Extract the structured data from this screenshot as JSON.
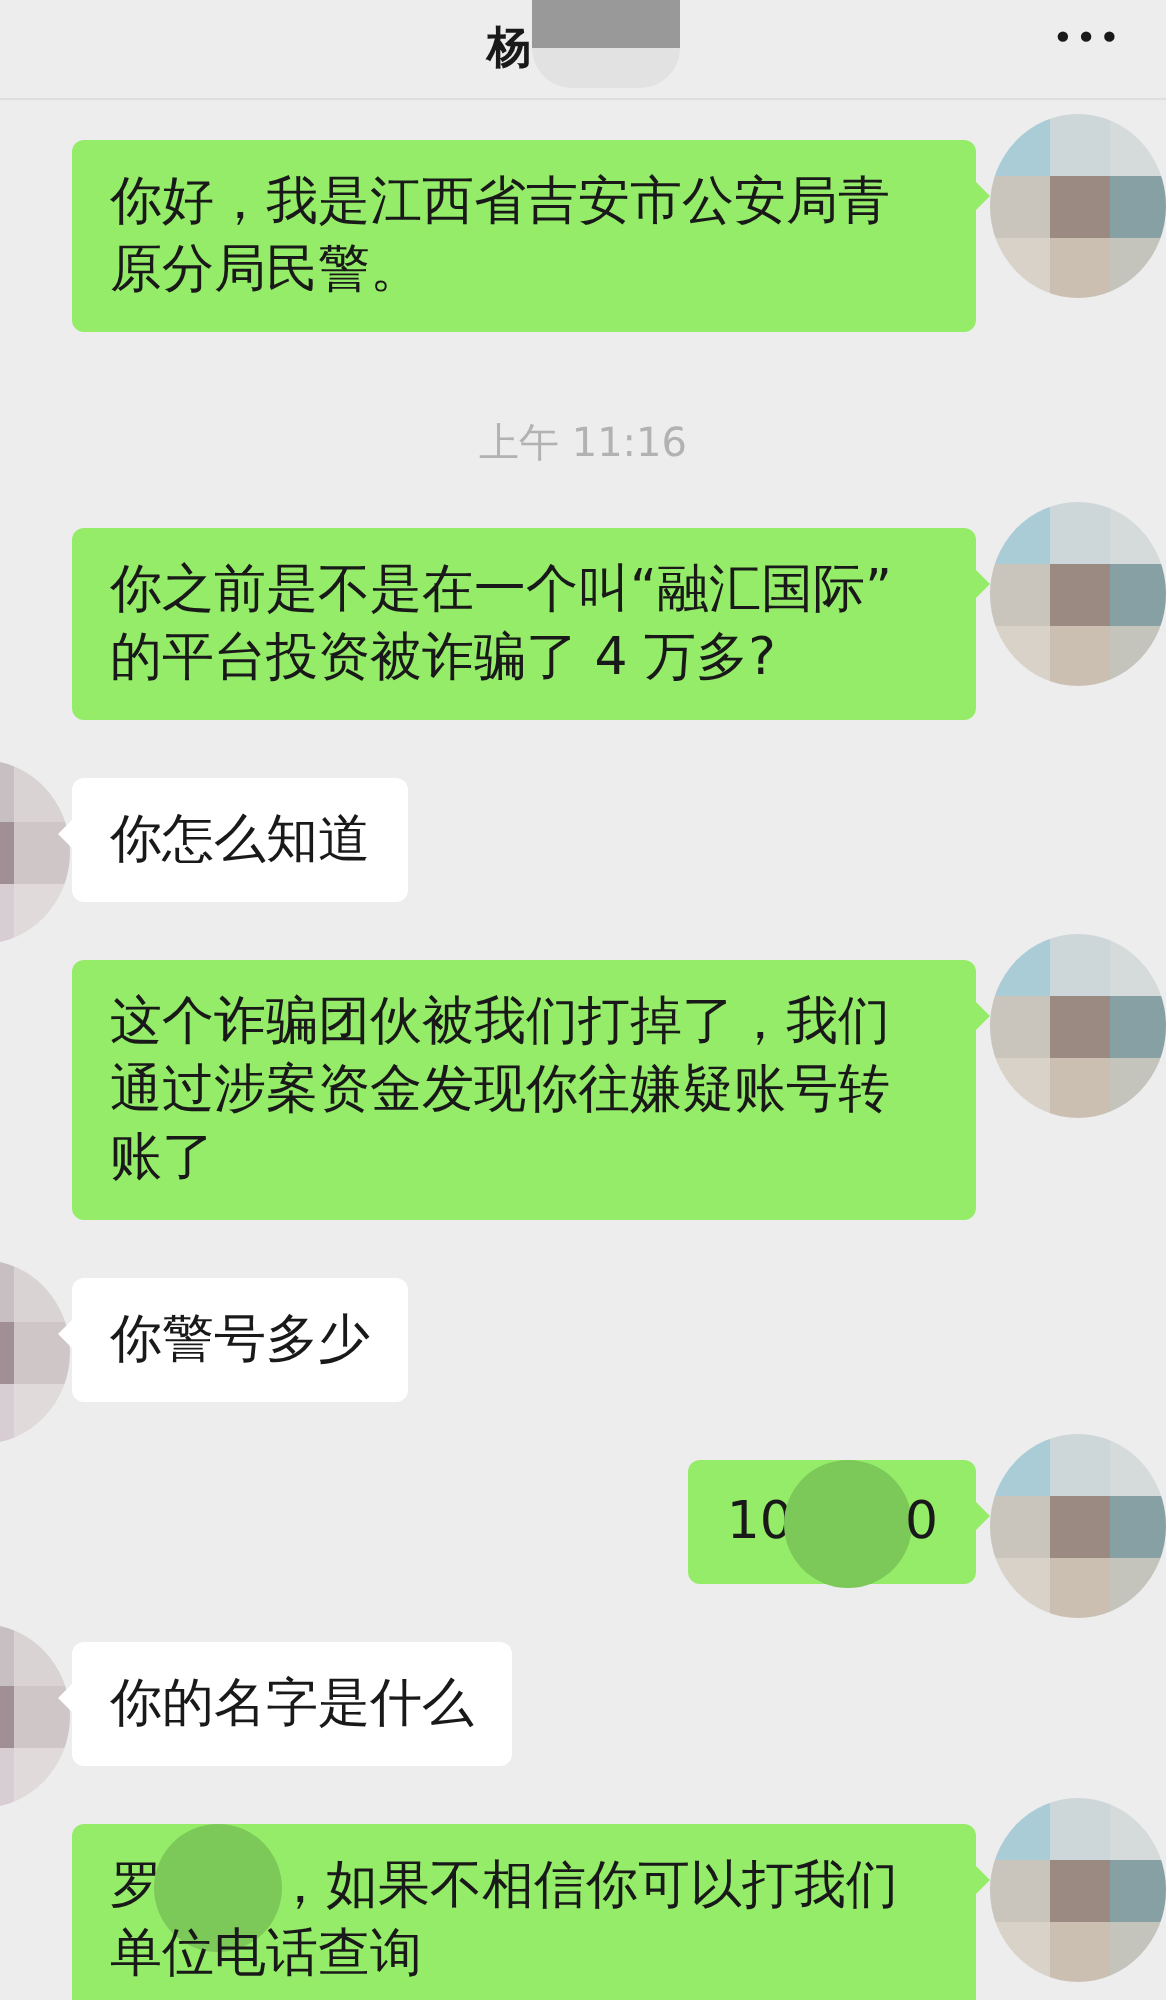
{
  "header": {
    "title": "杨",
    "title_blurred": true,
    "menu": "•••"
  },
  "messages": [
    {
      "kind": "outgoing",
      "lines": [
        [
          "你好，我是江西省吉安市公安局青"
        ],
        [
          "原分局民警。"
        ]
      ]
    },
    {
      "kind": "time",
      "text": "上午 11:16"
    },
    {
      "kind": "outgoing",
      "lines": [
        [
          "你之前是不是在一个叫“融汇国际”"
        ],
        [
          "的平台投资被诈骗了 4 万多?"
        ]
      ]
    },
    {
      "kind": "incoming",
      "lines": [
        [
          "你怎么知道"
        ]
      ]
    },
    {
      "kind": "outgoing",
      "lines": [
        [
          "这个诈骗团伙被我们打掉了，我们"
        ],
        [
          "通过涉案资金发现你往嫌疑账号转"
        ],
        [
          "账了"
        ]
      ]
    },
    {
      "kind": "incoming",
      "lines": [
        [
          "你警号多少"
        ]
      ]
    },
    {
      "kind": "outgoing",
      "lines": [
        [
          "10",
          "0"
        ]
      ]
    },
    {
      "kind": "incoming",
      "lines": [
        [
          "你的名字是什么"
        ]
      ]
    },
    {
      "kind": "outgoing",
      "lines": [
        [
          "罗",
          "，如果不相信你可以打我们"
        ],
        [
          "单位电话查询"
        ]
      ]
    }
  ]
}
